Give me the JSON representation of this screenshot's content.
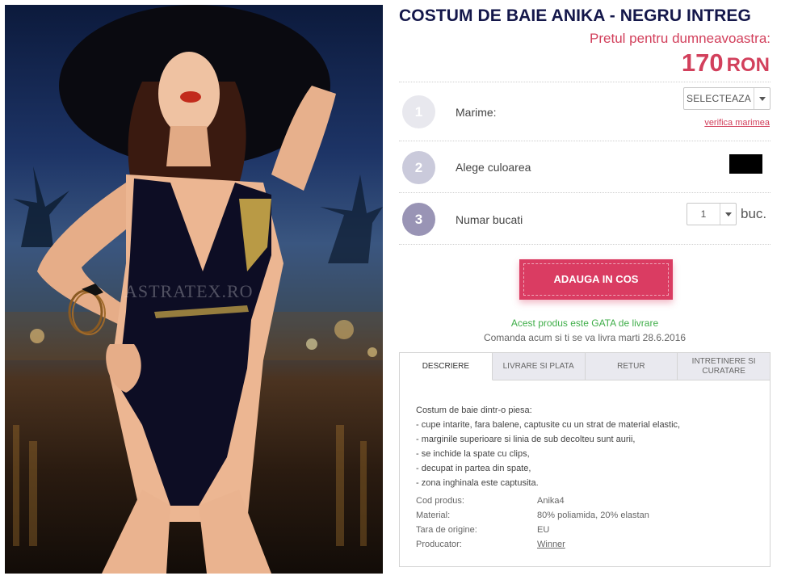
{
  "product": {
    "title": "COSTUM DE BAIE ANIKA - NEGRU INTREG",
    "price_label": "Pretul pentru dumneavoastra:",
    "price_amount": "170",
    "price_currency": "RON",
    "watermark": "ASTRATEX.RO"
  },
  "steps": [
    {
      "number": "1",
      "label": "Marime:",
      "color": "#e8e8ee"
    },
    {
      "number": "2",
      "label": "Alege culoarea",
      "color": "#cacadb"
    },
    {
      "number": "3",
      "label": "Numar bucati",
      "color": "#9994b5"
    }
  ],
  "size_select": {
    "value": "SELECTEAZA",
    "help_link": "verifica marimea"
  },
  "color_swatch": {
    "color": "#000000"
  },
  "quantity": {
    "value": "1",
    "unit": "buc."
  },
  "add_to_cart": "ADAUGA IN COS",
  "stock": {
    "status": "Acest produs este GATA de livrare",
    "delivery": "Comanda acum si ti se va livra marti 28.6.2016"
  },
  "tabs": [
    "DESCRIERE",
    "LIVRARE SI PLATA",
    "RETUR",
    "INTRETINERE SI CURATARE"
  ],
  "description": [
    "Costum de baie dintr-o piesa:",
    "- cupe intarite, fara balene, captusite cu un strat de material elastic,",
    "- marginile superioare si linia de sub decolteu sunt aurii,",
    "- se inchide la spate cu clips,",
    "- decupat in partea din spate,",
    "- zona inghinala este captusita."
  ],
  "specs": [
    {
      "key": "Cod produs:",
      "value": "Anika4"
    },
    {
      "key": "Material:",
      "value": "80% poliamida, 20% elastan"
    },
    {
      "key": "Tara de origine:",
      "value": "EU"
    },
    {
      "key": "Producator:",
      "value": "Winner"
    }
  ],
  "colors": {
    "accent": "#d2405c",
    "title": "#14174a",
    "in_stock": "#3fae49"
  }
}
